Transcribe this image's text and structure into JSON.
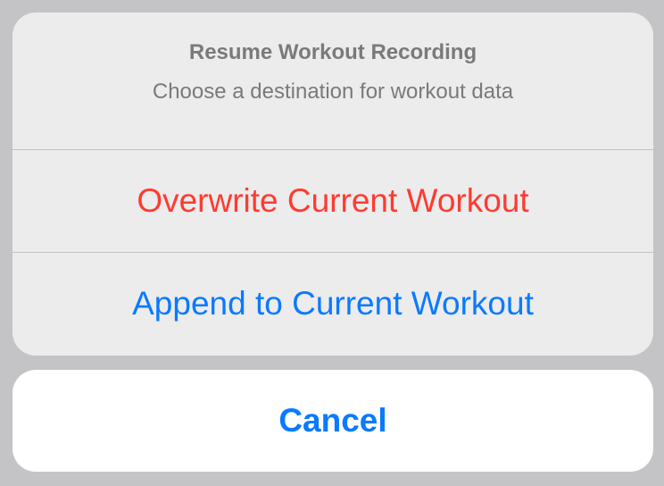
{
  "action_sheet": {
    "title": "Resume Workout Recording",
    "message": "Choose a destination for workout data",
    "actions": [
      {
        "label": "Overwrite Current Workout",
        "style": "destructive",
        "color": "#ff3b30"
      },
      {
        "label": "Append to Current Workout",
        "style": "default",
        "color": "#0a7aff"
      }
    ],
    "cancel_label": "Cancel"
  }
}
